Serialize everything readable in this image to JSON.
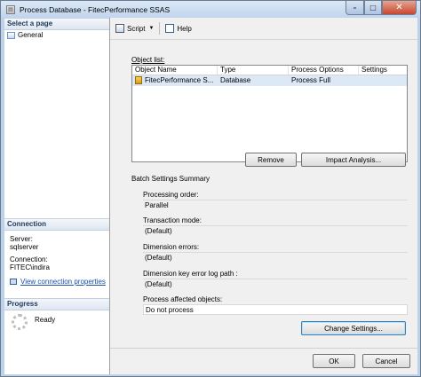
{
  "window": {
    "title": "Process Database - FitecPerformance SSAS"
  },
  "left": {
    "select_page_header": "Select a page",
    "pages": [
      {
        "label": "General"
      }
    ],
    "connection_header": "Connection",
    "server_label": "Server:",
    "server_value": "sqlserver",
    "connection_label": "Connection:",
    "connection_value": "FITEC\\indira",
    "view_link": "View connection properties",
    "progress_header": "Progress",
    "progress_status": "Ready"
  },
  "toolbar": {
    "script_label": "Script",
    "help_label": "Help"
  },
  "object_list": {
    "label": "Object list:",
    "columns": [
      "Object Name",
      "Type",
      "Process Options",
      "Settings"
    ],
    "rows": [
      {
        "name": "FitecPerformance S...",
        "type": "Database",
        "process_options": "Process Full",
        "settings": ""
      }
    ]
  },
  "buttons": {
    "remove": "Remove",
    "impact": "Impact Analysis...",
    "change_settings": "Change Settings...",
    "ok": "OK",
    "cancel": "Cancel"
  },
  "batch": {
    "title": "Batch Settings Summary",
    "items": [
      {
        "label": "Processing order:",
        "value": "Parallel"
      },
      {
        "label": "Transaction mode:",
        "value": "(Default)"
      },
      {
        "label": "Dimension errors:",
        "value": "(Default)"
      },
      {
        "label": "Dimension key error log path :",
        "value": "(Default)"
      },
      {
        "label": "Process affected objects:",
        "value": "Do not process"
      }
    ]
  }
}
